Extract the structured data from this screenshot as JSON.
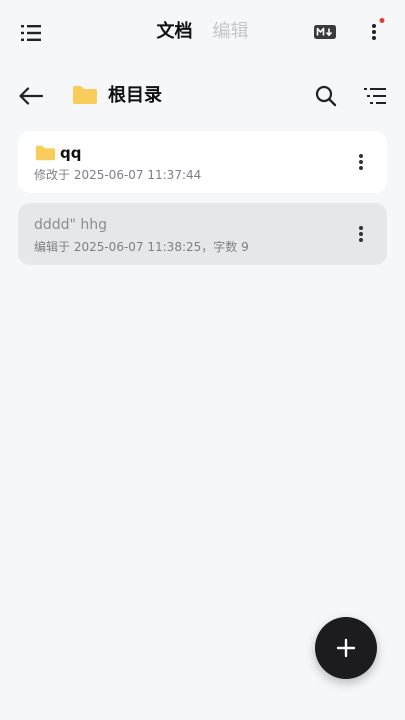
{
  "header": {
    "tabs": [
      {
        "label": "文档",
        "active": true
      },
      {
        "label": "编辑",
        "active": false
      }
    ],
    "menu_icon": "list-menu-icon",
    "markdown_badge": "M↓",
    "more_icon": "more-vertical-icon",
    "notification_dot_color": "#e53935"
  },
  "path": {
    "back_icon": "arrow-left-icon",
    "folder_icon": "folder-icon",
    "title": "根目录",
    "search_icon": "search-icon",
    "sort_icon": "sort-list-icon"
  },
  "items": [
    {
      "type": "folder",
      "name": "qq",
      "meta": "修改于 2025-06-07 11:37:44"
    },
    {
      "type": "document",
      "name": "dddd\"  hhg",
      "meta": "编辑于 2025-06-07 11:38:25，字数 9"
    }
  ],
  "fab": {
    "icon": "plus-icon",
    "label": "+"
  },
  "colors": {
    "background": "#f6f7f9",
    "folder": "#f9cd5b",
    "fab": "#1c1c1e"
  }
}
